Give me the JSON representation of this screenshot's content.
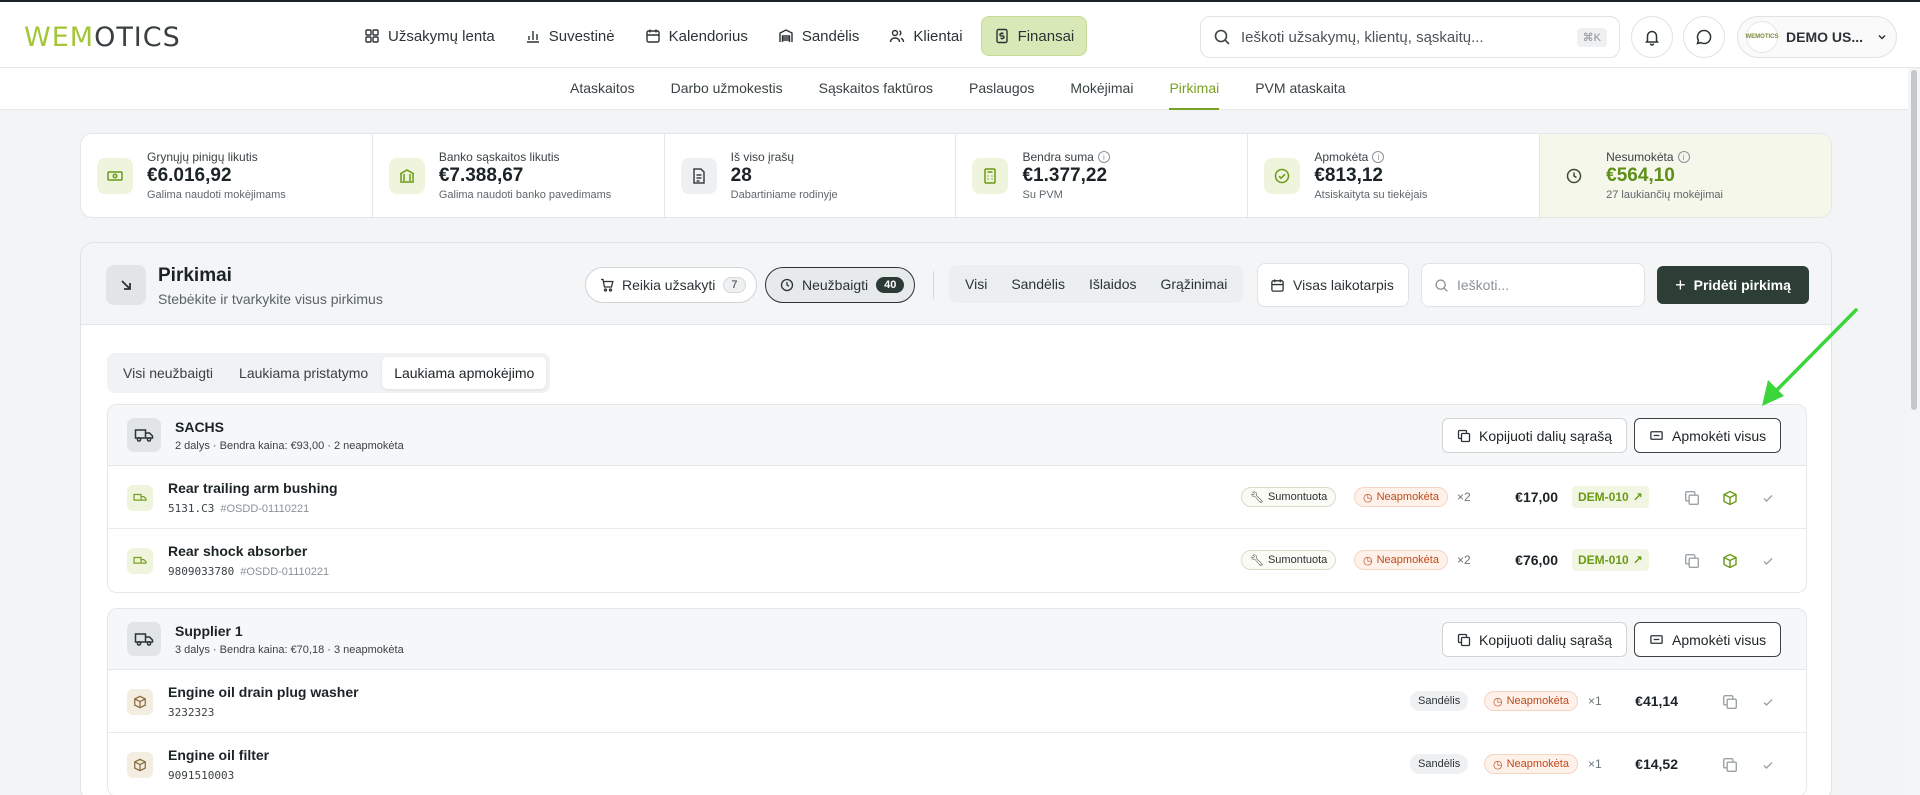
{
  "app": {
    "logo_part1": "WE",
    "logo_part2": "M",
    "logo_part3": "OTICS"
  },
  "nav": {
    "items": [
      {
        "label": "Užsakymų lenta",
        "icon": "grid-icon"
      },
      {
        "label": "Suvestinė",
        "icon": "bar-chart-icon"
      },
      {
        "label": "Kalendorius",
        "icon": "calendar-icon"
      },
      {
        "label": "Sandėlis",
        "icon": "warehouse-icon"
      },
      {
        "label": "Klientai",
        "icon": "users-icon"
      },
      {
        "label": "Finansai",
        "icon": "invoice-icon",
        "active": true
      }
    ]
  },
  "search": {
    "placeholder": "Ieškoti užsakymų, klientų, sąskaitų...",
    "shortcut": "⌘K"
  },
  "user": {
    "name": "DEMO US...",
    "avatar_text": "WEMOTICS"
  },
  "subnav": [
    "Ataskaitos",
    "Darbo užmokestis",
    "Sąskaitos faktūros",
    "Paslaugos",
    "Mokėjimai",
    "Pirkimai",
    "PVM ataskaita"
  ],
  "subnav_active": "Pirkimai",
  "stats": [
    {
      "title": "Grynųjų pinigų likutis",
      "value": "€6.016,92",
      "sub": "Galima naudoti mokėjimams",
      "info": false
    },
    {
      "title": "Banko sąskaitos likutis",
      "value": "€7.388,67",
      "sub": "Galima naudoti banko pavedimams",
      "info": false
    },
    {
      "title": "Iš viso įrašų",
      "value": "28",
      "sub": "Dabartiniame rodinyje",
      "info": false
    },
    {
      "title": "Bendra suma",
      "value": "€1.377,22",
      "sub": "Su PVM",
      "info": true
    },
    {
      "title": "Apmokėta",
      "value": "€813,12",
      "sub": "Atsiskaityta su tiekėjais",
      "info": true
    },
    {
      "title": "Nesumokėta",
      "value": "€564,10",
      "sub": "27 laukiančių mokėjimai",
      "info": true
    }
  ],
  "panel": {
    "title": "Pirkimai",
    "subtitle": "Stebėkite ir tvarkykite visus pirkimus",
    "filter_needs_order": {
      "label": "Reikia užsakyti",
      "count": "7"
    },
    "filter_incomplete": {
      "label": "Neužbaigti",
      "count": "40"
    },
    "segments": [
      "Visi",
      "Sandėlis",
      "Išlaidos",
      "Grąžinimai"
    ],
    "date_label": "Visas laikotarpis",
    "search_placeholder": "Ieškoti...",
    "add_label": "Pridėti pirkimą",
    "tabs": [
      "Visi neužbaigti",
      "Laukiama pristatymo",
      "Laukiama apmokėjimo"
    ],
    "active_tab": "Laukiama apmokėjimo"
  },
  "groups": [
    {
      "name": "SACHS",
      "meta": "2 dalys · Bendra kaina: €93,00 · 2 neapmokėta",
      "copy_label": "Kopijuoti dalių sąrašą",
      "pay_label": "Apmokėti visus",
      "rows": [
        {
          "name": "Rear trailing arm bushing",
          "sku": "5131.C3",
          "ref": "#OSDD-01110221",
          "status1": "Sumontuota",
          "status2": "Neapmokėta",
          "qty": "×2",
          "price": "€17,00",
          "order": "DEM-010"
        },
        {
          "name": "Rear shock absorber",
          "sku": "9809033780",
          "ref": "#OSDD-01110221",
          "status1": "Sumontuota",
          "status2": "Neapmokėta",
          "qty": "×2",
          "price": "€76,00",
          "order": "DEM-010"
        }
      ]
    },
    {
      "name": "Supplier 1",
      "meta": "3 dalys · Bendra kaina: €70,18 · 3 neapmokėta",
      "copy_label": "Kopijuoti dalių sąrašą",
      "pay_label": "Apmokėti visus",
      "rows": [
        {
          "name": "Engine oil drain plug washer",
          "sku": "3232323",
          "ref": "",
          "status1": "Sandėlis",
          "status2": "Neapmokėta",
          "qty": "×1",
          "price": "€41,14",
          "order": ""
        },
        {
          "name": "Engine oil filter",
          "sku": "9091510003",
          "ref": "",
          "status1": "Sandėlis",
          "status2": "Neapmokėta",
          "qty": "×1",
          "price": "€14,52",
          "order": ""
        }
      ]
    }
  ],
  "colors": {
    "accent": "#7aa023",
    "dark_button": "#2d3e36",
    "unpaid": "#c04a1a",
    "arrow": "#3ad63a"
  }
}
